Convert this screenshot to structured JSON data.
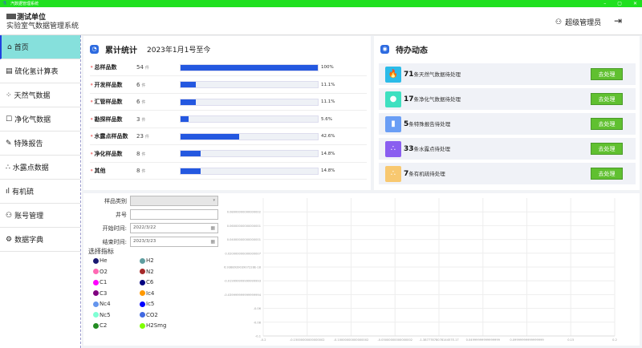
{
  "window": {
    "title": "汽数据管理系统",
    "min": "–",
    "max": "▢",
    "close": "✕"
  },
  "header": {
    "org": "测试单位",
    "system": "实验室气数据管理系统",
    "user": "超级管理员"
  },
  "sidebar": [
    {
      "icon": "⌂",
      "label": "首页",
      "name": "home"
    },
    {
      "icon": "▤",
      "label": "硫化氢计算表",
      "name": "h2s-calc"
    },
    {
      "icon": "⁘",
      "label": "天然气数据",
      "name": "natural-gas"
    },
    {
      "icon": "☐",
      "label": "净化气数据",
      "name": "purified-gas"
    },
    {
      "icon": "✎",
      "label": "特殊报告",
      "name": "special-report"
    },
    {
      "icon": "∴",
      "label": "水露点数据",
      "name": "dew-point"
    },
    {
      "icon": "ıl",
      "label": "有机硫",
      "name": "organic-sulfur"
    },
    {
      "icon": "⚇",
      "label": "账号管理",
      "name": "accounts"
    },
    {
      "icon": "⚙",
      "label": "数据字典",
      "name": "dictionary"
    }
  ],
  "stats": {
    "title": "累计统计",
    "subtitle": "2023年1月1号至今",
    "unit": "件",
    "rows": [
      {
        "label": "总样品数",
        "count": "54",
        "pct": 100,
        "pct_label": "100%"
      },
      {
        "label": "开发样品数",
        "count": "6",
        "pct": 11.1,
        "pct_label": "11.1%"
      },
      {
        "label": "汇管样品数",
        "count": "6",
        "pct": 11.1,
        "pct_label": "11.1%"
      },
      {
        "label": "勘探样品数",
        "count": "3",
        "pct": 5.6,
        "pct_label": "5.6%"
      },
      {
        "label": "水露点样品数",
        "count": "23",
        "pct": 42.6,
        "pct_label": "42.6%"
      },
      {
        "label": "净化样品数",
        "count": "8",
        "pct": 14.8,
        "pct_label": "14.8%"
      },
      {
        "label": "其他",
        "count": "8",
        "pct": 14.8,
        "pct_label": "14.8%"
      }
    ]
  },
  "todo": {
    "title": "待办动态",
    "button": "去处理",
    "items": [
      {
        "count": "71",
        "text": "条天然气数据待处理",
        "color": "#2bbbe8",
        "icon": "🔥"
      },
      {
        "count": "17",
        "text": "条净化气数据待处理",
        "color": "#3ee0c0",
        "icon": "●"
      },
      {
        "count": "5",
        "text": "条特殊报告待处理",
        "color": "#6a9ef5",
        "icon": "▮"
      },
      {
        "count": "33",
        "text": "条水露点待处理",
        "color": "#8a5ef0",
        "icon": "∴"
      },
      {
        "count": "7",
        "text": "条有机硫待处理",
        "color": "#f8c870",
        "icon": "∴"
      }
    ]
  },
  "filters": {
    "sample_type_label": "样品类别",
    "sample_type_value": "",
    "well_label": "井号",
    "well_value": "",
    "start_label": "开始时间:",
    "start_value": "2022/3/22",
    "end_label": "结束时间:",
    "end_value": "2023/3/23"
  },
  "indicators": {
    "title": "选择指标",
    "items": [
      {
        "name": "He",
        "color": "#191970"
      },
      {
        "name": "H2",
        "color": "#5f9ea0"
      },
      {
        "name": "O2",
        "color": "#ff69b4"
      },
      {
        "name": "N2",
        "color": "#a52a2a"
      },
      {
        "name": "C1",
        "color": "#ff00ff"
      },
      {
        "name": "C6",
        "color": "#000080"
      },
      {
        "name": "C3",
        "color": "#800080"
      },
      {
        "name": "Ic4",
        "color": "#ff9900"
      },
      {
        "name": "Nc4",
        "color": "#6495ed"
      },
      {
        "name": "Ic5",
        "color": "#0000ff"
      },
      {
        "name": "Nc5",
        "color": "#7fffd4"
      },
      {
        "name": "CO2",
        "color": "#4169e1"
      },
      {
        "name": "C2",
        "color": "#228b22"
      },
      {
        "name": "H2Smg",
        "color": "#7fff00"
      }
    ]
  },
  "chart_data": {
    "type": "line",
    "series": [],
    "xlim": [
      -0.2,
      0.2
    ],
    "ylim": [
      -0.1,
      0.1
    ],
    "grid": true,
    "x_ticks": [
      -0.2,
      -0.15,
      -0.1,
      -0.05,
      0,
      0.05,
      0.1,
      0.15,
      0.2
    ],
    "x_tick_labels": [
      "-0.2",
      "-0.15000000000000002",
      "-0.10000000000000002",
      "-0.05000000000000002",
      "-1.3877787807814457E-17",
      "0.04999999999999999",
      "0.09999999999999999",
      "0.15",
      "0.2"
    ],
    "y_ticks": [
      0.08,
      0.06,
      0.04,
      0.02,
      0,
      -0.02,
      -0.04,
      -0.06,
      -0.08,
      -0.1
    ],
    "y_tick_labels": [
      "0.08000000000000002",
      "0.06000000000000001",
      "0.04000000000000001",
      "0.020000000000000007",
      "6.938893903907228E-18",
      "-0.019999999999999993",
      "-0.039999999999999994",
      "-0.06",
      "-0.08",
      "-0.1"
    ]
  }
}
